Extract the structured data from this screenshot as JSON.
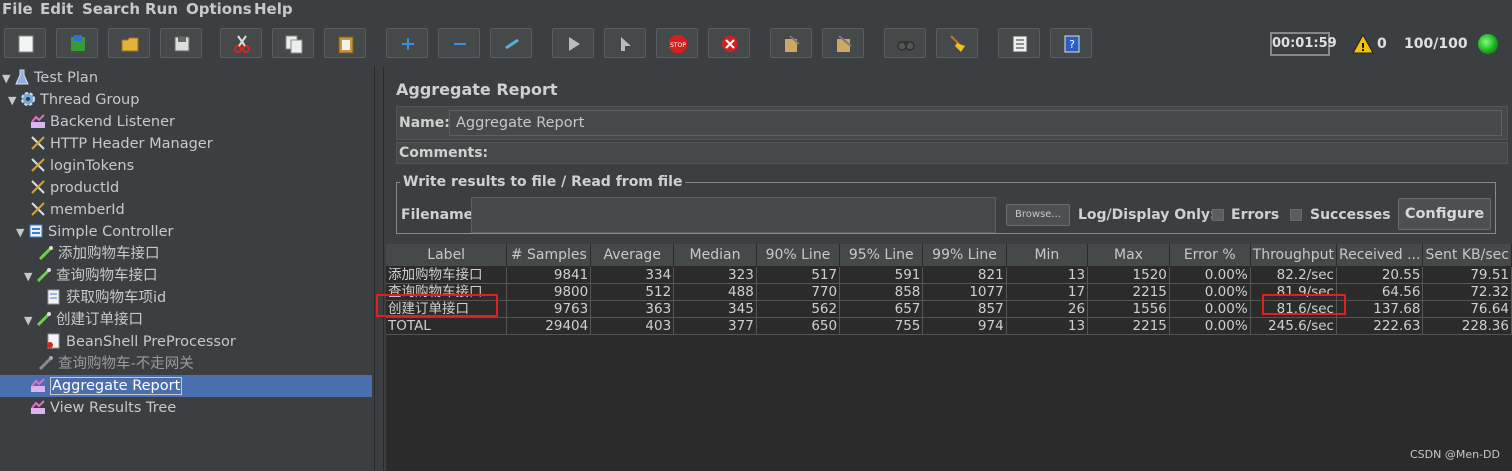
{
  "menu": [
    "File",
    "Edit",
    "Search",
    "Run",
    "Options",
    "Help"
  ],
  "toolbar": {
    "timer": "00:01:59",
    "warnings": "0",
    "threads": "100/100"
  },
  "tree": [
    {
      "label": "Test Plan",
      "icon": "test-plan-icon",
      "arrow": "▼"
    },
    {
      "label": "Thread Group",
      "icon": "gear-icon",
      "arrow": "▼"
    },
    {
      "label": "Backend Listener",
      "icon": "listener-icon",
      "arrow": ""
    },
    {
      "label": "HTTP Header Manager",
      "icon": "wrench-icon",
      "arrow": ""
    },
    {
      "label": "loginTokens",
      "icon": "wrench-icon",
      "arrow": ""
    },
    {
      "label": "productId",
      "icon": "wrench-icon",
      "arrow": ""
    },
    {
      "label": "memberId",
      "icon": "wrench-icon",
      "arrow": ""
    },
    {
      "label": "Simple Controller",
      "icon": "controller-icon",
      "arrow": "▼"
    },
    {
      "label": "添加购物车接口",
      "icon": "pipette-icon",
      "arrow": ""
    },
    {
      "label": "查询购物车接口",
      "icon": "pipette-icon",
      "arrow": "▼"
    },
    {
      "label": "获取购物车项id",
      "icon": "extractor-icon",
      "arrow": ""
    },
    {
      "label": "创建订单接口",
      "icon": "pipette-icon",
      "arrow": "▼"
    },
    {
      "label": "BeanShell PreProcessor",
      "icon": "preprocessor-icon",
      "arrow": ""
    },
    {
      "label": "查询购物车-不走网关",
      "icon": "pipette-disabled-icon",
      "arrow": ""
    },
    {
      "label": "Aggregate Report",
      "icon": "listener-icon",
      "arrow": ""
    },
    {
      "label": "View Results Tree",
      "icon": "listener-icon",
      "arrow": ""
    }
  ],
  "panel": {
    "title": "Aggregate Report",
    "name_label": "Name:",
    "name_value": "Aggregate Report",
    "comments_label": "Comments:",
    "file_group": "Write results to file / Read from file",
    "filename_label": "Filename",
    "browse": "Browse...",
    "log_display": "Log/Display Only:",
    "errors": "Errors",
    "successes": "Successes",
    "configure": "Configure"
  },
  "table": {
    "headers": [
      "Label",
      "# Samples",
      "Average",
      "Median",
      "90% Line",
      "95% Line",
      "99% Line",
      "Min",
      "Max",
      "Error %",
      "Throughput",
      "Received ...",
      "Sent KB/sec"
    ],
    "rows": [
      [
        "添加购物车接口",
        "9841",
        "334",
        "323",
        "517",
        "591",
        "821",
        "13",
        "1520",
        "0.00%",
        "82.2/sec",
        "20.55",
        "79.51"
      ],
      [
        "查询购物车接口",
        "9800",
        "512",
        "488",
        "770",
        "858",
        "1077",
        "17",
        "2215",
        "0.00%",
        "81.9/sec",
        "64.56",
        "72.32"
      ],
      [
        "创建订单接口",
        "9763",
        "363",
        "345",
        "562",
        "657",
        "857",
        "26",
        "1556",
        "0.00%",
        "81.6/sec",
        "137.68",
        "76.64"
      ],
      [
        "TOTAL",
        "29404",
        "403",
        "377",
        "650",
        "755",
        "974",
        "13",
        "2215",
        "0.00%",
        "245.6/sec",
        "222.63",
        "228.36"
      ]
    ]
  },
  "watermark": "CSDN @Men-DD"
}
